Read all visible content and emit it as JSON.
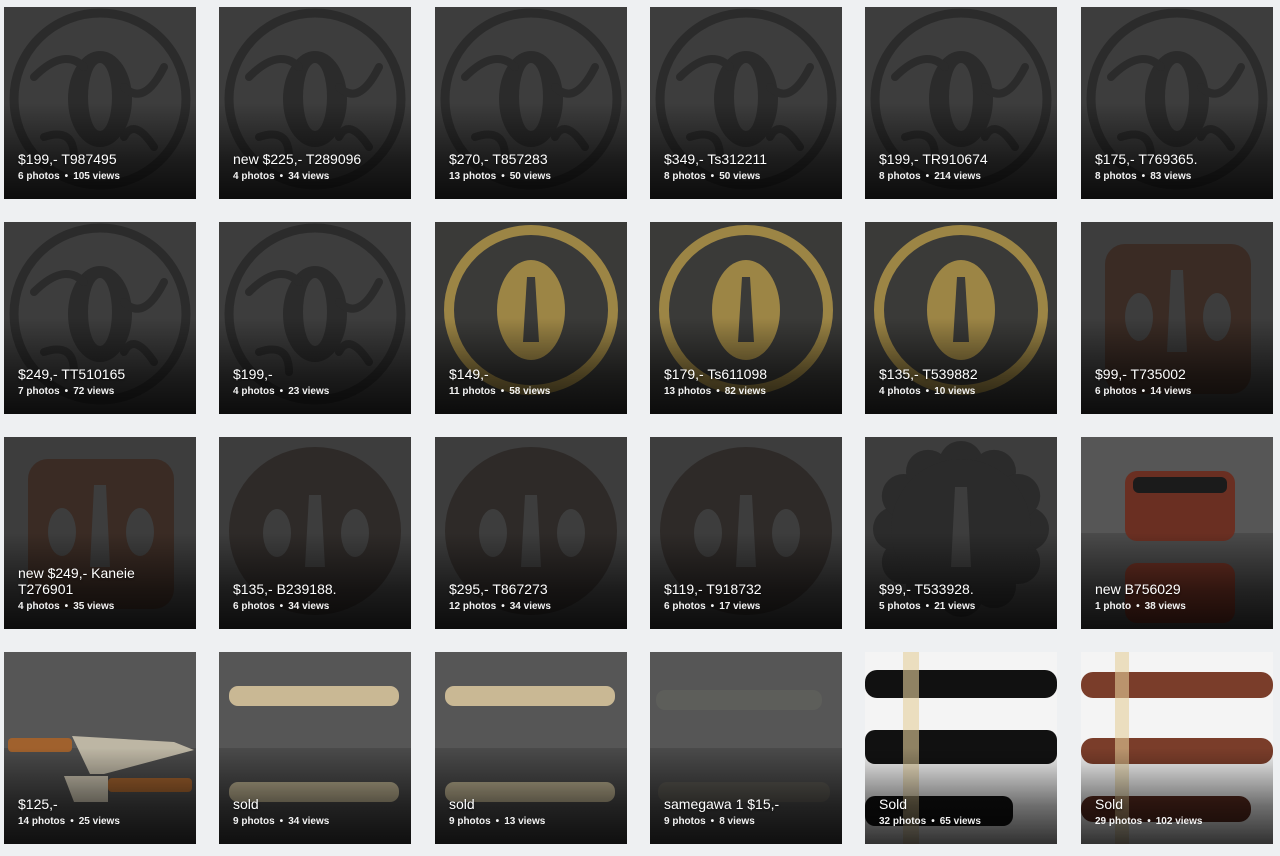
{
  "gallery": {
    "items": [
      {
        "title": "$199,- T987495",
        "photos": "6 photos",
        "views": "105 views",
        "art": "iron-round",
        "theme": "dark"
      },
      {
        "title": "new $225,- T289096",
        "photos": "4 photos",
        "views": "34 views",
        "art": "iron-round",
        "theme": "dark"
      },
      {
        "title": "$270,- T857283",
        "photos": "13 photos",
        "views": "50 views",
        "art": "iron-round",
        "theme": "dark"
      },
      {
        "title": "$349,- Ts312211",
        "photos": "8 photos",
        "views": "50 views",
        "art": "iron-round",
        "theme": "dark"
      },
      {
        "title": "$199,- TR910674",
        "photos": "8 photos",
        "views": "214 views",
        "art": "iron-round",
        "theme": "dark"
      },
      {
        "title": "$175,- T769365.",
        "photos": "8 photos",
        "views": "83 views",
        "art": "iron-round",
        "theme": "dark"
      },
      {
        "title": "$249,- TT510165",
        "photos": "7 photos",
        "views": "72 views",
        "art": "iron-round",
        "theme": "dark"
      },
      {
        "title": "$199,-",
        "photos": "4 photos",
        "views": "23 views",
        "art": "iron-round",
        "theme": "dark"
      },
      {
        "title": "$149,-",
        "photos": "11 photos",
        "views": "58 views",
        "art": "brass-oval",
        "theme": "brass"
      },
      {
        "title": "$179,- Ts611098",
        "photos": "13 photos",
        "views": "82 views",
        "art": "brass-oval",
        "theme": "brass"
      },
      {
        "title": "$135,- T539882",
        "photos": "4 photos",
        "views": "10 views",
        "art": "brass-oval",
        "theme": "brass"
      },
      {
        "title": "$99,- T735002",
        "photos": "6 photos",
        "views": "14 views",
        "art": "iron-square",
        "theme": "dark"
      },
      {
        "title": "new $249,- Kaneie T276901",
        "photos": "4 photos",
        "views": "35 views",
        "art": "iron-square",
        "theme": "dark"
      },
      {
        "title": "$135,- B239188.",
        "photos": "6 photos",
        "views": "34 views",
        "art": "iron-solid",
        "theme": "dark"
      },
      {
        "title": "$295,- T867273",
        "photos": "12 photos",
        "views": "34 views",
        "art": "iron-solid",
        "theme": "dark"
      },
      {
        "title": "$119,- T918732",
        "photos": "6 photos",
        "views": "17 views",
        "art": "iron-solid",
        "theme": "dark"
      },
      {
        "title": "$99,- T533928.",
        "photos": "5 photos",
        "views": "21 views",
        "art": "iron-flower",
        "theme": "dark"
      },
      {
        "title": "new B756029",
        "photos": "1 photo",
        "views": "38 views",
        "art": "wood-fitting",
        "theme": "light"
      },
      {
        "title": "$125,-",
        "photos": "14 photos",
        "views": "25 views",
        "art": "knife",
        "theme": "light"
      },
      {
        "title": "sold",
        "photos": "9 photos",
        "views": "34 views",
        "art": "handle",
        "theme": "light"
      },
      {
        "title": "sold",
        "photos": "9 photos",
        "views": "13 views",
        "art": "handle",
        "theme": "light"
      },
      {
        "title": "samegawa 1 $15,-",
        "photos": "9 photos",
        "views": "8 views",
        "art": "handle-dark",
        "theme": "light"
      },
      {
        "title": "Sold",
        "photos": "32 photos",
        "views": "65 views",
        "art": "black-saya",
        "theme": "white"
      },
      {
        "title": "Sold",
        "photos": "29 photos",
        "views": "102 views",
        "art": "brown-saya",
        "theme": "white"
      }
    ]
  },
  "colors": {
    "page_bg": "#eef0f2",
    "dark_bg": "#3b3b3b",
    "iron": "#2b2b2b",
    "brass": "#9c8545",
    "handle": "#c9b894",
    "saya_black": "#111111",
    "saya_brown": "#7a3d2a"
  }
}
